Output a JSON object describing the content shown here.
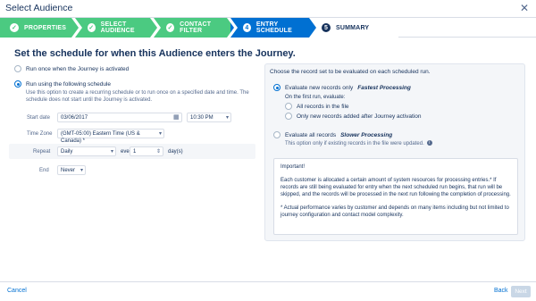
{
  "window": {
    "title": "Select Audience",
    "close_glyph": "✕"
  },
  "steps": [
    {
      "number": "✓",
      "label": "PROPERTIES",
      "state": "done"
    },
    {
      "number": "✓",
      "label": "SELECT AUDIENCE",
      "state": "done"
    },
    {
      "number": "✓",
      "label": "CONTACT FILTER",
      "state": "done"
    },
    {
      "number": "4",
      "label": "ENTRY SCHEDULE",
      "state": "current"
    },
    {
      "number": "5",
      "label": "SUMMARY",
      "state": "todo"
    }
  ],
  "schedule": {
    "heading": "Set the schedule for when this Audience enters the Journey.",
    "option_once": "Run once when the Journey is activated",
    "option_schedule": "Run using the following schedule",
    "schedule_help": "Use this option to create a recurring schedule or to run once on a specified date and time. The schedule does not start until the Journey is activated.",
    "start_date_label": "Start date",
    "start_date_value": "03/06/2017",
    "start_time_value": "10:30 PM",
    "timezone_label": "Time Zone",
    "timezone_value": "(GMT-05:00) Eastern Time (US & Canada) *",
    "repeat_label": "Repeat",
    "repeat_value": "Daily",
    "every_label": "every",
    "every_value": "1",
    "every_unit": "day(s)",
    "end_label": "End",
    "end_value": "Never"
  },
  "evaluation": {
    "title": "Choose the record set to be evaluated on each scheduled run.",
    "option_new": "Evaluate new records only",
    "option_new_tag": "Fastest Processing",
    "first_run_label": "On the first run, evaluate:",
    "first_run_all": "All records in the file",
    "first_run_new": "Only new records added after Journey activation",
    "option_all": "Evaluate all records",
    "option_all_tag": "Slower Processing",
    "option_all_help": "This option only if existing records in the file were updated.",
    "note_heading": "Important!",
    "note_body": "Each customer is allocated a certain amount of system resources for processing entries.* If records are still being evaluated for entry when the next scheduled run begins, that run will be skipped, and the records will be processed in the next run following the completion of processing.",
    "note_footnote": "* Actual performance varies by customer and depends on many items including but not limited to journey configuration and contact model complexity."
  },
  "footer": {
    "cancel": "Cancel",
    "back": "Back",
    "next": "Next"
  },
  "icons": {
    "calendar": "calendar-icon",
    "caret": "chevron-down-icon",
    "info": "info-icon",
    "close": "close-icon"
  },
  "colors": {
    "done": "#4bca81",
    "current": "#0070d2",
    "text": "#16325c",
    "panel": "#f4f6f9"
  }
}
